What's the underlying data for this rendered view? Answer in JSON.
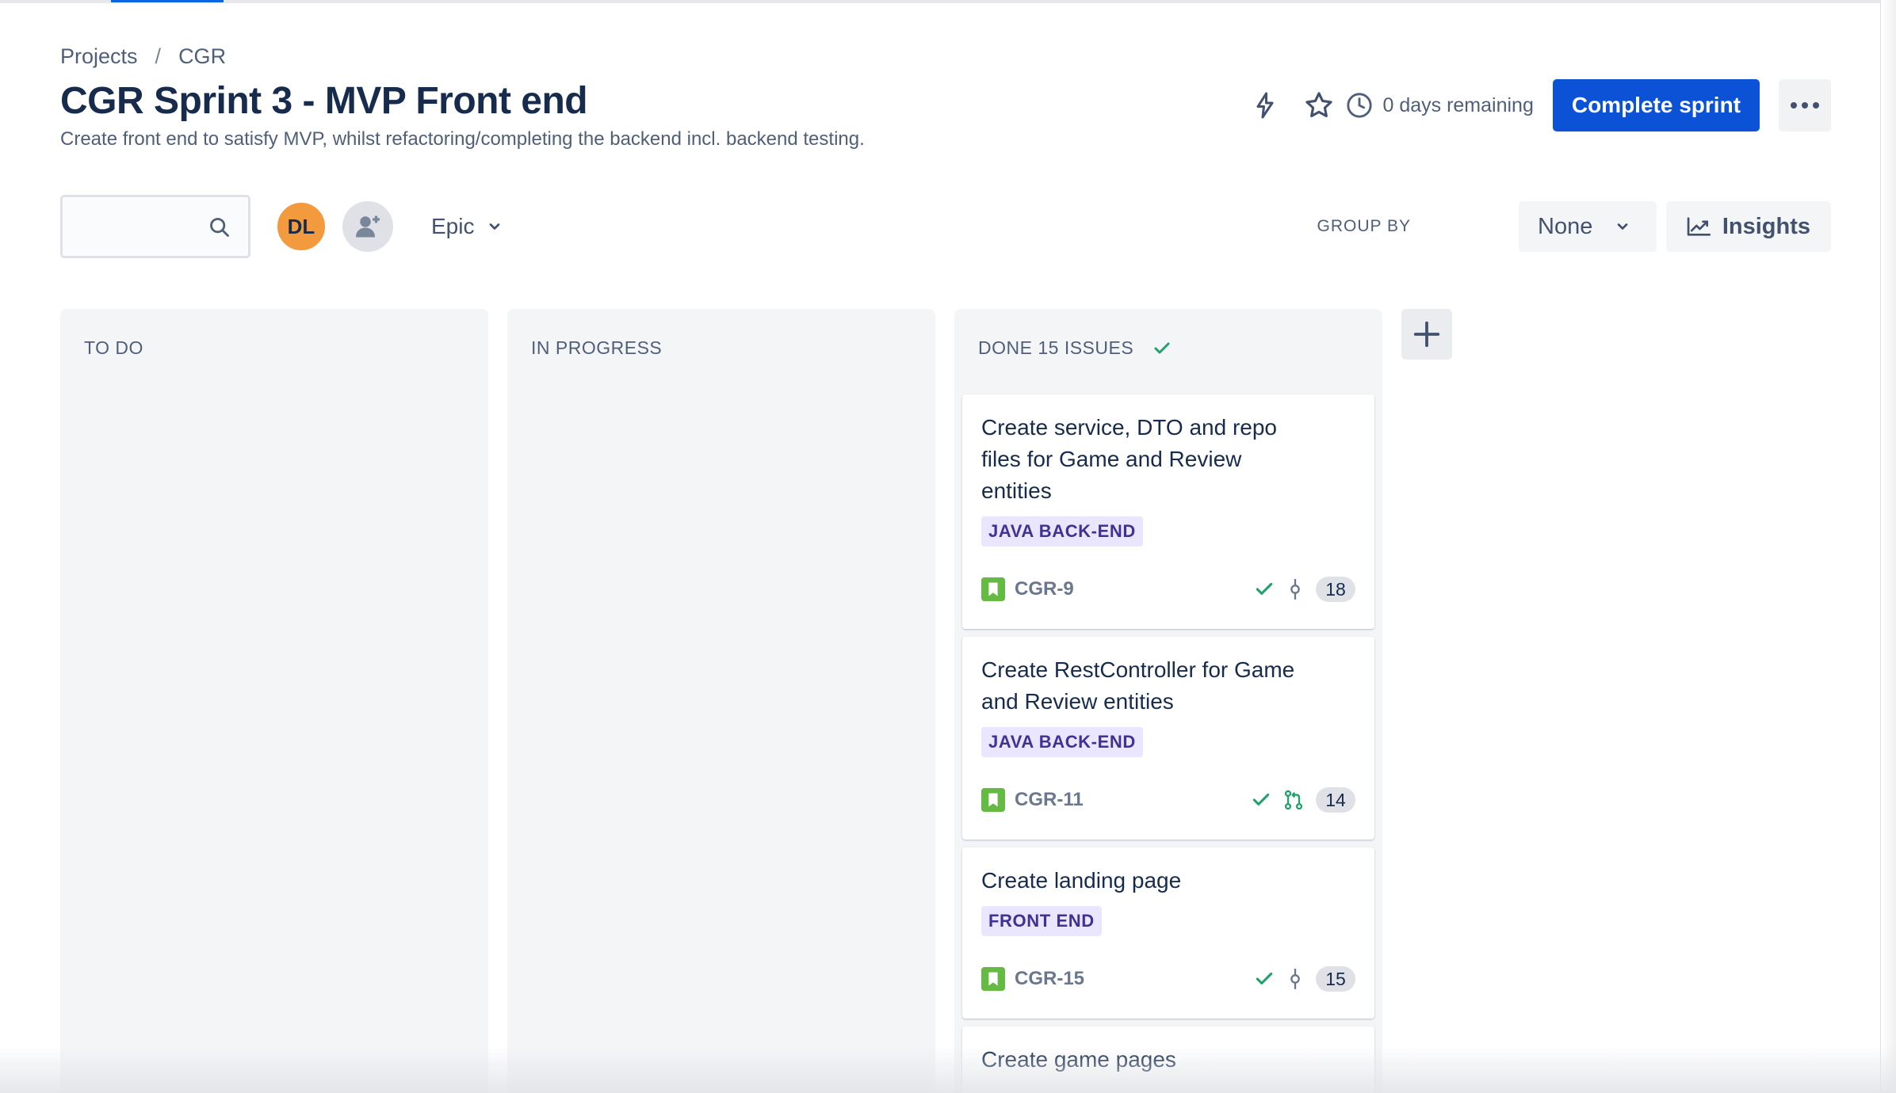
{
  "breadcrumb": {
    "items": [
      "Projects",
      "CGR"
    ],
    "separator": "/"
  },
  "header": {
    "title": "CGR Sprint 3 - MVP Front end",
    "description": "Create front end to satisfy MVP, whilst refactoring/completing the backend incl. backend testing.",
    "days_remaining": "0 days remaining",
    "complete_button": "Complete sprint",
    "icons": [
      "lightning-icon",
      "star-icon",
      "clock-icon",
      "more-icon"
    ]
  },
  "toolbar": {
    "search_placeholder": "",
    "avatar_initials": "DL",
    "epic_filter": "Epic",
    "group_by_label": "GROUP BY",
    "group_by_value": "None",
    "insights_label": "Insights"
  },
  "columns": [
    {
      "title": "TO DO"
    },
    {
      "title": "IN PROGRESS"
    },
    {
      "title": "DONE 15 ISSUES"
    }
  ],
  "cards": [
    {
      "title": "Create service, DTO and repo files for Game and Review entities",
      "label": "JAVA BACK-END",
      "key": "CGR-9",
      "estimate": "18",
      "branch_icon": "commit-icon"
    },
    {
      "title": "Create RestController for Game and Review entities",
      "label": "JAVA BACK-END",
      "key": "CGR-11",
      "estimate": "14",
      "branch_icon": "pull-request-icon"
    },
    {
      "title": "Create landing page",
      "label": "FRONT END",
      "key": "CGR-15",
      "estimate": "15",
      "branch_icon": "commit-icon"
    },
    {
      "title": "Create game pages"
    }
  ],
  "colors": {
    "primary_button": "#0c52d6",
    "avatar": "#f29a3d",
    "label_bg": "#eae6ff",
    "label_text": "#403294",
    "story_icon": "#65ba43",
    "check_icon": "#22a06b"
  }
}
